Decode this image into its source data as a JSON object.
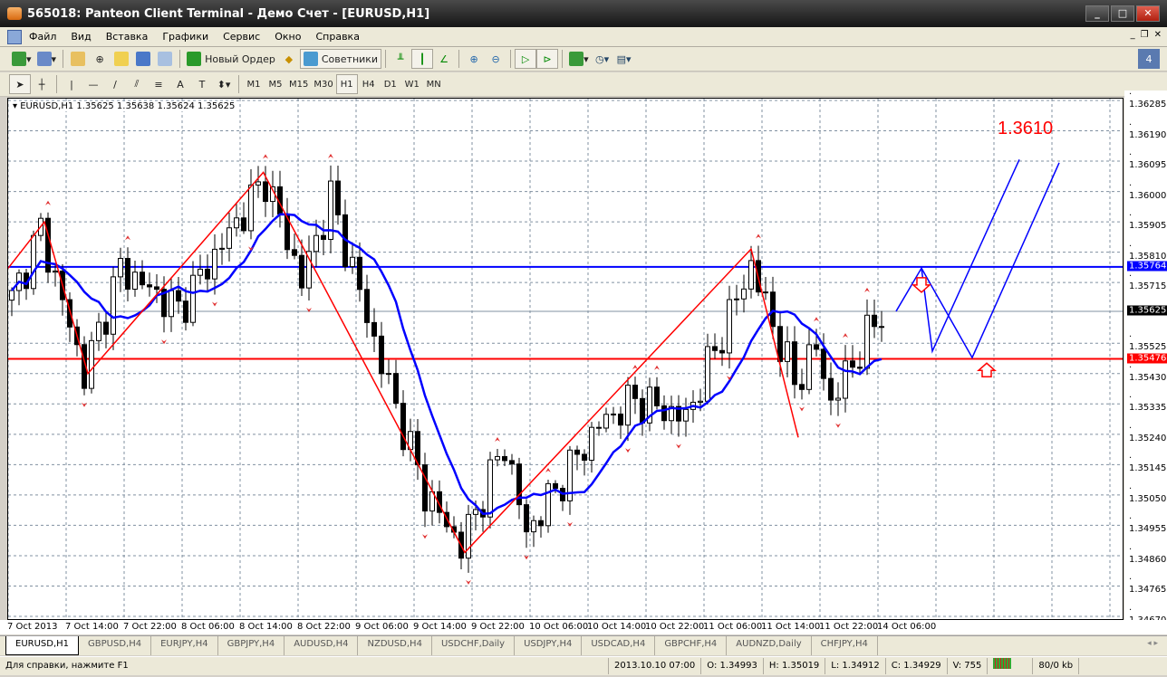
{
  "window": {
    "title": "565018: Panteon Client Terminal - Демо Счет - [EURUSD,H1]"
  },
  "menu": [
    "Файл",
    "Вид",
    "Вставка",
    "Графики",
    "Сервис",
    "Окно",
    "Справка"
  ],
  "toolbar": {
    "new_order": "Новый Ордер",
    "experts": "Советники"
  },
  "timeframes": [
    "M1",
    "M5",
    "M15",
    "M30",
    "H1",
    "H4",
    "D1",
    "W1",
    "MN"
  ],
  "active_timeframe": "H1",
  "chart": {
    "header": "EURUSD,H1  1.35625 1.35638 1.35624 1.35625",
    "annotation": "1.3610"
  },
  "chart_data": {
    "type": "candlestick",
    "symbol": "EURUSD",
    "timeframe": "H1",
    "ylim": [
      1.3467,
      1.36285
    ],
    "y_ticks": [
      "1.36285",
      "1.36190",
      "1.36095",
      "1.36000",
      "1.35905",
      "1.35810",
      "1.35715",
      "1.35525",
      "1.35430",
      "1.35335",
      "1.35240",
      "1.35145",
      "1.35050",
      "1.34955",
      "1.34860",
      "1.34765",
      "1.34670"
    ],
    "x_ticks": [
      "7 Oct 2013",
      "7 Oct 14:00",
      "7 Oct 22:00",
      "8 Oct 06:00",
      "8 Oct 14:00",
      "8 Oct 22:00",
      "9 Oct 06:00",
      "9 Oct 14:00",
      "9 Oct 22:00",
      "10 Oct 06:00",
      "10 Oct 14:00",
      "10 Oct 22:00",
      "11 Oct 06:00",
      "11 Oct 14:00",
      "11 Oct 22:00",
      "14 Oct 06:00"
    ],
    "price_keypoints": [
      [
        0,
        1.3566
      ],
      [
        4,
        1.3588
      ],
      [
        10,
        1.3543
      ],
      [
        15,
        1.3576
      ],
      [
        23,
        1.3563
      ],
      [
        35,
        1.3604
      ],
      [
        40,
        1.3572
      ],
      [
        44,
        1.3598
      ],
      [
        51,
        1.3546
      ],
      [
        57,
        1.3506
      ],
      [
        62,
        1.3489
      ],
      [
        68,
        1.3521
      ],
      [
        71,
        1.3493
      ],
      [
        76,
        1.351
      ],
      [
        81,
        1.3527
      ],
      [
        86,
        1.3535
      ],
      [
        93,
        1.3529
      ],
      [
        102,
        1.3577
      ],
      [
        108,
        1.354
      ],
      [
        111,
        1.3551
      ],
      [
        113,
        1.3534
      ],
      [
        120,
        1.35625
      ]
    ],
    "zigzag": [
      [
        -0.5,
        1.3576
      ],
      [
        4.5,
        1.35905
      ],
      [
        10.5,
        1.3543
      ],
      [
        34.7,
        1.3606
      ],
      [
        62.5,
        1.3487
      ],
      [
        102,
        1.3582
      ],
      [
        108.5,
        1.3523
      ]
    ],
    "projection_a": [
      [
        122,
        1.35625
      ],
      [
        125.5,
        1.3576
      ],
      [
        127,
        1.355
      ],
      [
        139,
        1.361
      ]
    ],
    "projection_b": [
      [
        125.5,
        1.3576
      ],
      [
        132.5,
        1.3548
      ],
      [
        144.5,
        1.3609
      ]
    ],
    "lines": {
      "resistance": {
        "value": "1.35764",
        "color": "#0000ff"
      },
      "support": {
        "value": "1.35476",
        "color": "#ff0000"
      },
      "bid": {
        "value": "1.35625",
        "color": "#000000"
      }
    }
  },
  "tabs": [
    "EURUSD,H1",
    "GBPUSD,H4",
    "EURJPY,H4",
    "GBPJPY,H4",
    "AUDUSD,H4",
    "NZDUSD,H4",
    "USDCHF,Daily",
    "USDJPY,H4",
    "USDCAD,H4",
    "GBPCHF,H4",
    "AUDNZD,Daily",
    "CHFJPY,H4"
  ],
  "status": {
    "help": "Для справки, нажмите F1",
    "time": "2013.10.10 07:00",
    "open": "O: 1.34993",
    "high": "H: 1.35019",
    "low": "L: 1.34912",
    "close": "C: 1.34929",
    "volume": "V: 755",
    "traffic": "80/0 kb"
  }
}
